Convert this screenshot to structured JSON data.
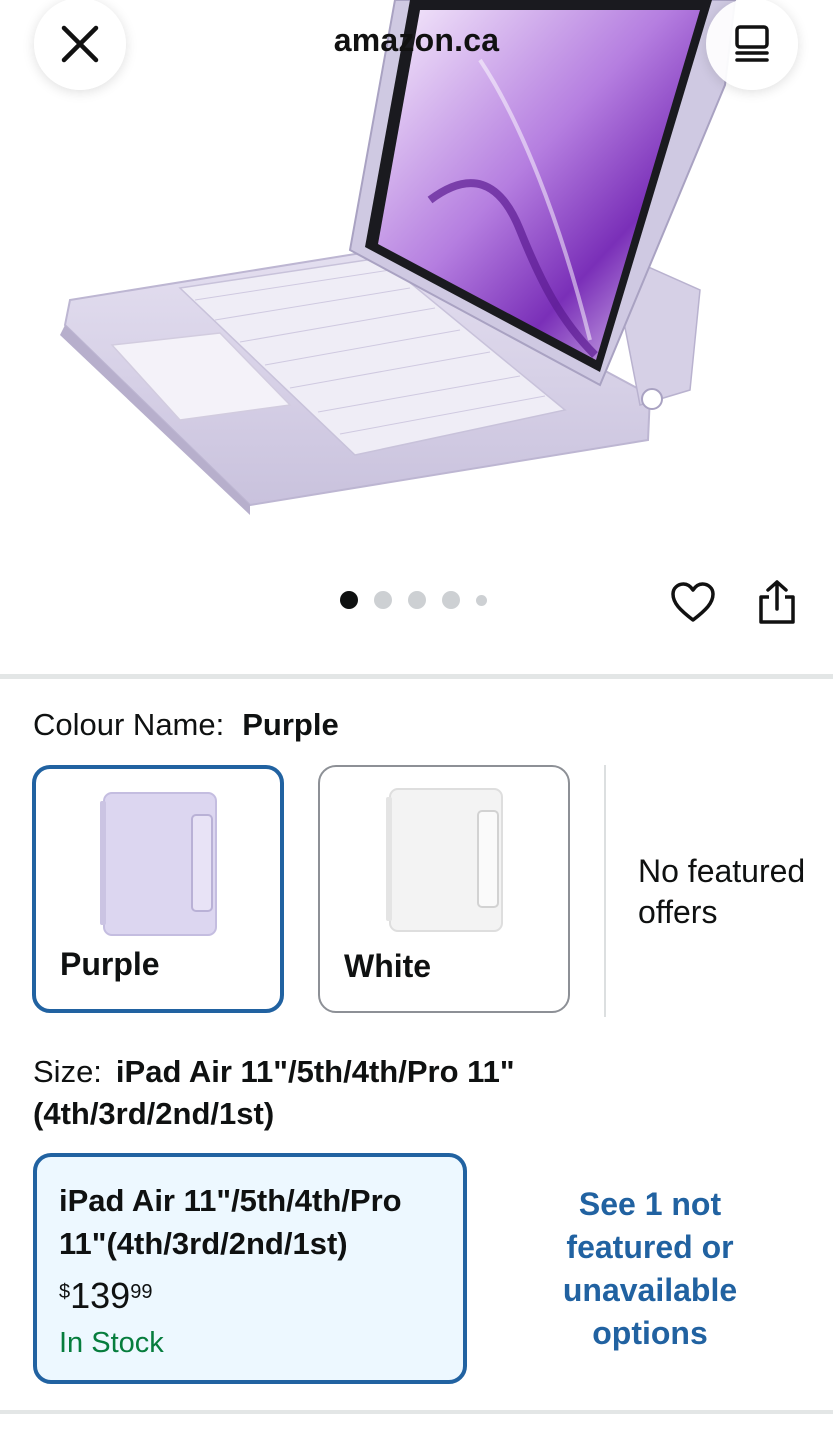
{
  "browser": {
    "domain": "amazon.ca",
    "close_icon": "close-icon",
    "tabs_icon": "tabs-icon"
  },
  "gallery": {
    "image_count": 5,
    "active_index": 0,
    "favorite_icon": "heart-icon",
    "share_icon": "share-icon"
  },
  "colour": {
    "label": "Colour Name:",
    "selected": "Purple",
    "options": [
      {
        "label": "Purple",
        "selected": true,
        "swatch_color": "#dcd6f0"
      },
      {
        "label": "White",
        "selected": false,
        "swatch_color": "#f3f3f3"
      }
    ],
    "no_featured": "No featured offers"
  },
  "size": {
    "label": "Size:",
    "selected": "iPad Air 11\"/5th/4th/Pro 11\" (4th/3rd/2nd/1st)",
    "option": {
      "name": "iPad Air 11\"/5th/4th/Pro 11\"(4th/3rd/2nd/1st)",
      "price_symbol": "$",
      "price_whole": "139",
      "price_fraction": "99",
      "stock": "In Stock"
    },
    "see_more": "See 1 not featured or unavailable options"
  },
  "colors": {
    "accent": "#2162a1",
    "in_stock": "#067d3d",
    "selected_bg": "#edf8ff"
  }
}
